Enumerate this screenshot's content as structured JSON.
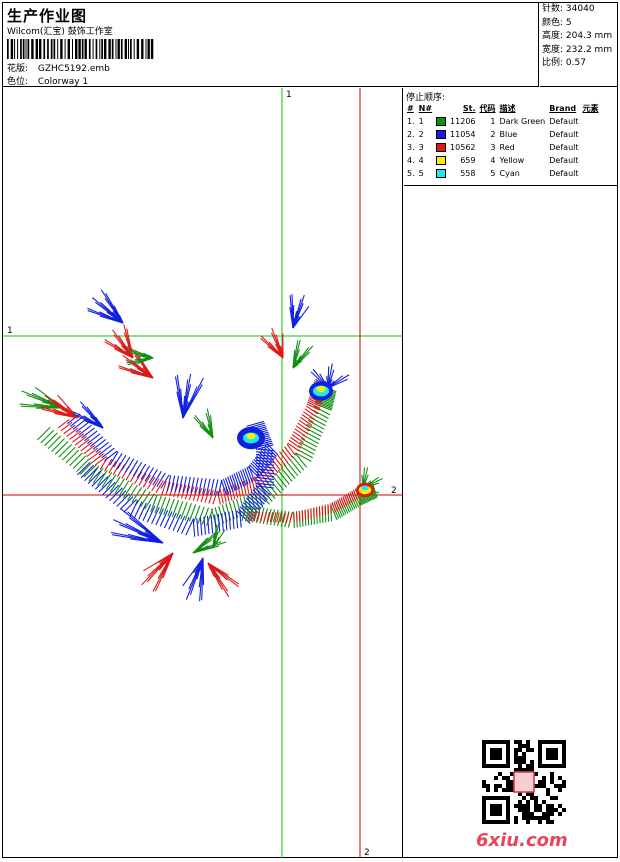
{
  "header": {
    "title": "生产作业图",
    "company": "Wilcom(汇宝) 鼓饰工作室",
    "design_label": "花版:",
    "design_value": "GZHC5192.emb",
    "colorway_label": "色位:",
    "colorway_value": "Colorway 1"
  },
  "stats": [
    {
      "label": "针数:",
      "value": "34040"
    },
    {
      "label": "颜色:",
      "value": "5"
    },
    {
      "label": "高度:",
      "value": "204.3 mm"
    },
    {
      "label": "宽度:",
      "value": "232.2 mm"
    },
    {
      "label": "比例:",
      "value": "0.57"
    }
  ],
  "stop_sequence": {
    "title": "停止顺序:",
    "columns": [
      "#",
      "N#",
      "St.",
      "代码",
      "描述",
      "Brand",
      "元素"
    ],
    "rows": [
      {
        "num": "1.",
        "n": "1",
        "st": "11206",
        "code": "1",
        "desc": "Dark Green",
        "brand": "Default",
        "color": "#109010"
      },
      {
        "num": "2.",
        "n": "2",
        "st": "11054",
        "code": "2",
        "desc": "Blue",
        "brand": "Default",
        "color": "#1020e0"
      },
      {
        "num": "3.",
        "n": "3",
        "st": "10562",
        "code": "3",
        "desc": "Red",
        "brand": "Default",
        "color": "#e01818"
      },
      {
        "num": "4.",
        "n": "4",
        "st": "659",
        "code": "4",
        "desc": "Yellow",
        "brand": "Default",
        "color": "#f8f000"
      },
      {
        "num": "5.",
        "n": "5",
        "st": "558",
        "code": "5",
        "desc": "Cyan",
        "brand": "Default",
        "color": "#20e8f0"
      }
    ]
  },
  "guides": {
    "top_1": "1",
    "left_1": "1",
    "right_2": "2",
    "bottom_2": "2"
  },
  "watermark": "6xiu.com",
  "colors": {
    "green_guide": "#00cc00",
    "red_guide": "#cc0000"
  }
}
